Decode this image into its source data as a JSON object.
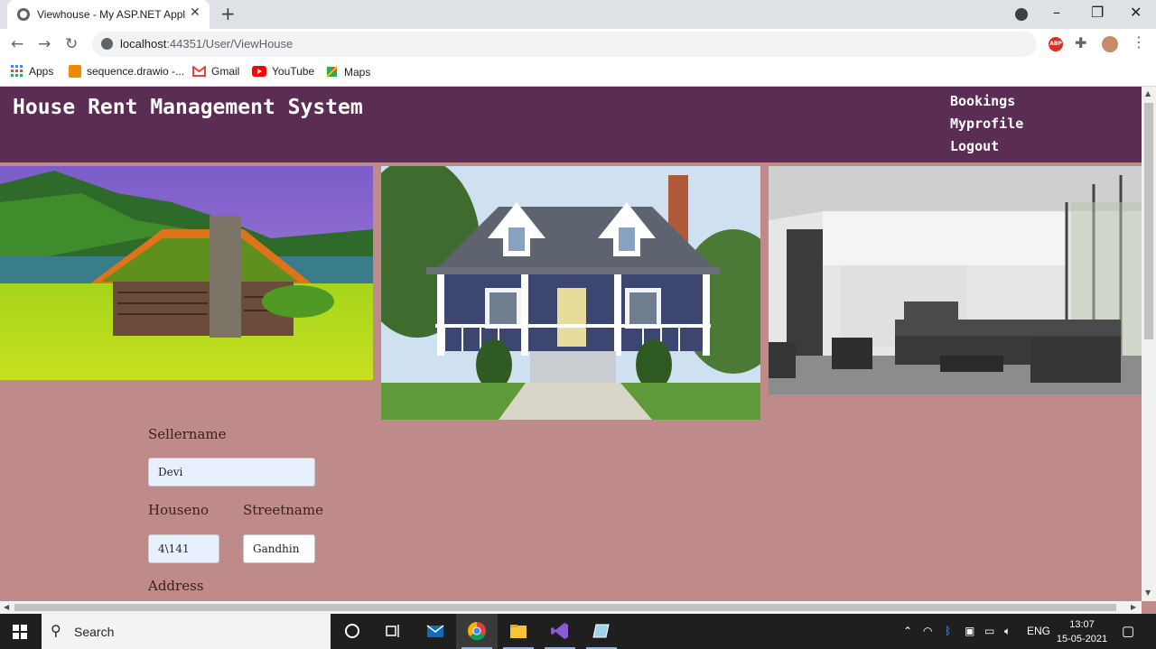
{
  "browser": {
    "tab_title": "Viewhouse - My ASP.NET Application",
    "new_tab_symbol": "+",
    "url_host": "localhost",
    "url_path": ":44351/User/ViewHouse",
    "window_controls": [
      "–",
      "❐",
      "✕"
    ]
  },
  "bookmarks": [
    {
      "label": "Apps",
      "icon": "apps-grid-icon",
      "color": "#4285f4"
    },
    {
      "label": "sequence.drawio -...",
      "icon": "drawio-icon",
      "color": "#f08705"
    },
    {
      "label": "Gmail",
      "icon": "gmail-icon",
      "color": "#ea4335"
    },
    {
      "label": "YouTube",
      "icon": "youtube-icon",
      "color": "#ff0000"
    },
    {
      "label": "Maps",
      "icon": "maps-icon",
      "color": "#34a853"
    }
  ],
  "site": {
    "title": "House Rent Management System",
    "nav": [
      "Bookings",
      "Myprofile",
      "Logout"
    ],
    "header_color": "#5b2d55",
    "background_color": "#bf8a8a"
  },
  "gallery": [
    {
      "image": "log-cabin-meadow"
    },
    {
      "image": "blue-house-porch"
    },
    {
      "image": "modern-living-room"
    }
  ],
  "form": {
    "seller_label": "Sellername",
    "seller_value": "Devi",
    "houseno_label": "Houseno",
    "houseno_value": "4\\141",
    "street_label": "Streetname",
    "street_value": "Gandhin",
    "address_label": "Address"
  },
  "taskbar": {
    "search_label": "Search",
    "language": "ENG",
    "time": "13:07",
    "date": "15-05-2021"
  }
}
